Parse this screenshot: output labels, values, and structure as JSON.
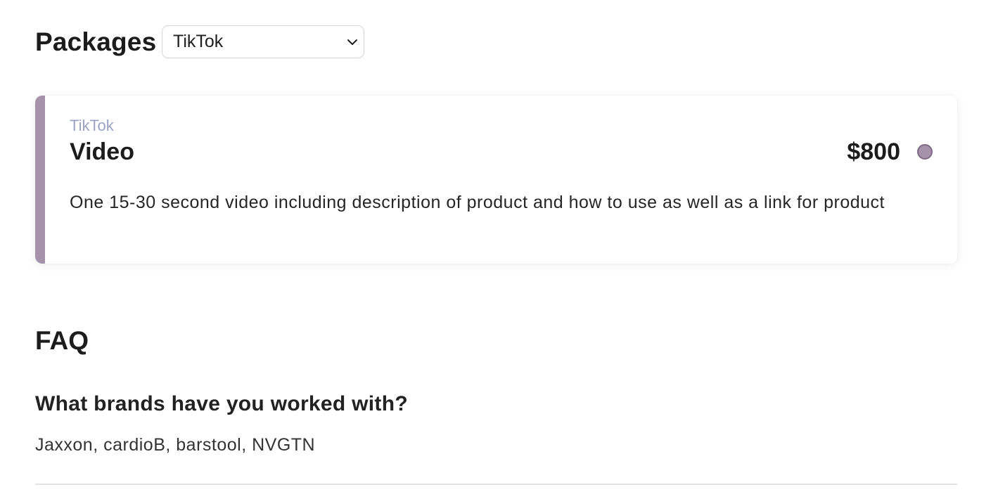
{
  "packages": {
    "title": "Packages",
    "filter": {
      "selected": "TikTok"
    },
    "items": [
      {
        "platform": "TikTok",
        "name": "Video",
        "price": "$800",
        "description": "One 15-30 second video including description of product and how to use as well as a link for product"
      }
    ]
  },
  "faq": {
    "title": "FAQ",
    "items": [
      {
        "question": "What brands have you worked with?",
        "answer": "Jaxxon, cardioB, barstool, NVGTN"
      }
    ]
  },
  "colors": {
    "accent": "#a493ab",
    "platform_label": "#9aa3c4"
  },
  "icons": {
    "select_chevron": "chevron-down-icon",
    "package_radio": "radio-indicator"
  }
}
